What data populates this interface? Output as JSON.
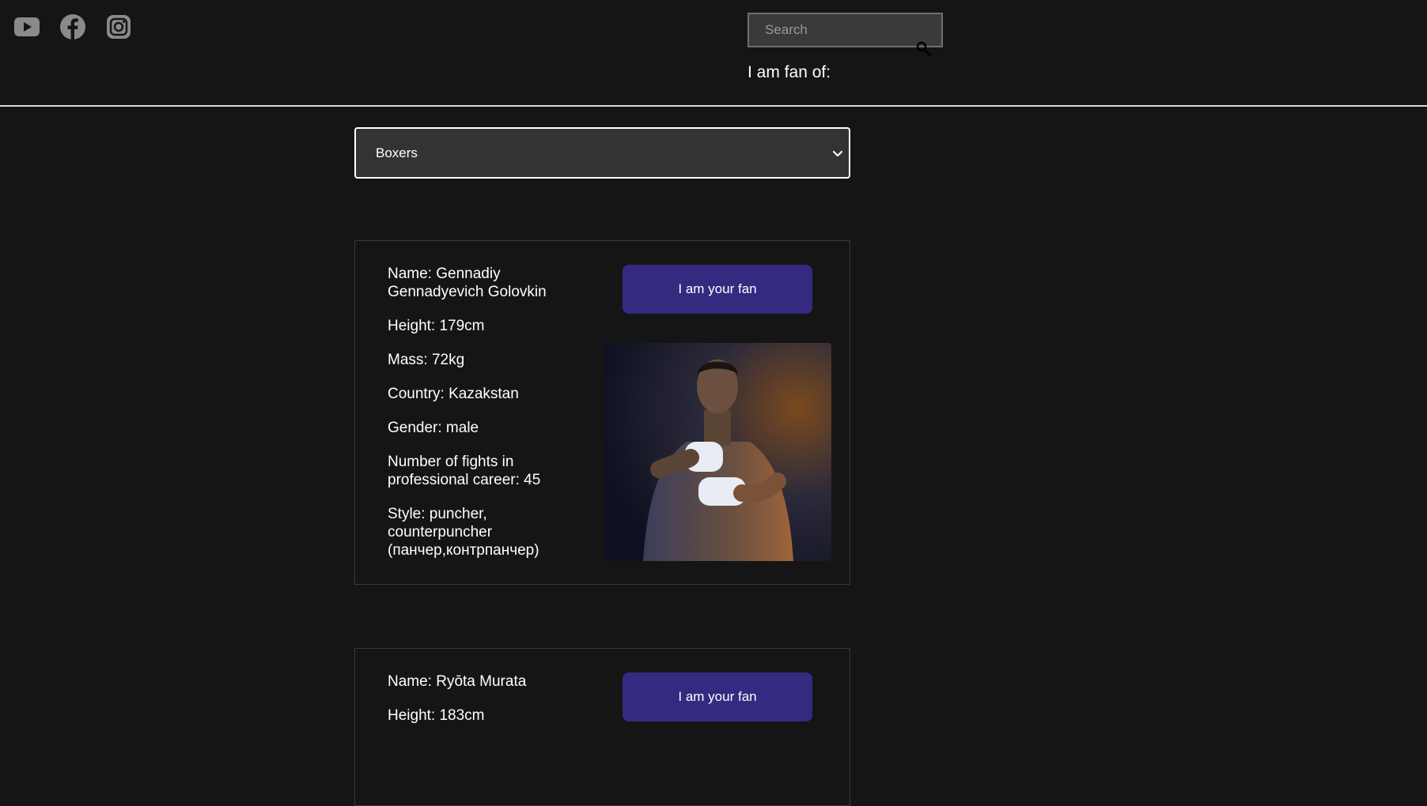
{
  "header": {
    "social": [
      {
        "icon": "youtube-icon",
        "color": "#8a8a8a"
      },
      {
        "icon": "facebook-icon",
        "color": "#8a8a8a"
      },
      {
        "icon": "instagram-icon",
        "color": "#8a8a8a"
      }
    ],
    "search": {
      "placeholder": "Search",
      "value": ""
    },
    "fan_of_label": "I am fan of:"
  },
  "category_select": {
    "selected": "Boxers"
  },
  "cards": [
    {
      "name": "Name: Gennadiy Gennadyevich Golovkin",
      "height": "Height: 179cm",
      "mass": "Mass: 72kg",
      "country": "Country: Kazakstan",
      "gender": "Gender: male",
      "fights": "Number of fights in professional career: 45",
      "style": "Style: puncher, counterpuncher (панчер,контрпанчер)",
      "button": "I am your fan"
    },
    {
      "name": "Name: Ryōta Murata",
      "height": "Height: 183cm",
      "button": "I am your fan"
    }
  ],
  "colors": {
    "background": "#151515",
    "button": "#342a80",
    "select_background": "#333333"
  }
}
